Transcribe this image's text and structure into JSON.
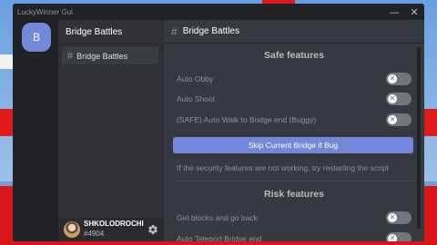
{
  "window": {
    "title": "LuckyWinner Gui",
    "minimize_glyph": "—",
    "close_glyph": "✕"
  },
  "server": {
    "icon_letter": "B",
    "name": "Bridge Battles"
  },
  "channels": [
    {
      "label": "Bridge Battles"
    }
  ],
  "user": {
    "name": "SHKOLODROCHI",
    "tag": "#4904"
  },
  "main": {
    "header": "Bridge Battles",
    "safe_title": "Safe features",
    "safe_toggles": [
      {
        "label": "Auto Obby",
        "enabled": false
      },
      {
        "label": "Auto Shoot",
        "enabled": false
      },
      {
        "label": "(SAFE) Auto Walk to Bridge end (Buggy)",
        "enabled": false
      }
    ],
    "skip_button": "Skip Current Bridge if Bug",
    "note": "If the security features are not working, try restarting the script",
    "risk_title": "Risk features",
    "risk_toggles": [
      {
        "label": "Get blocks and go back",
        "enabled": false
      },
      {
        "label": "Auto Teleport Bridge end",
        "enabled": false
      }
    ]
  },
  "colors": {
    "accent": "#7289da",
    "window_bg": "#36393f",
    "sidebar_bg": "#2f3136",
    "dark_bg": "#202225",
    "toggle_off": "#72767d"
  },
  "icons": {
    "channel": "hash-icon",
    "settings": "gear-icon",
    "toggle_off": "x-icon"
  }
}
